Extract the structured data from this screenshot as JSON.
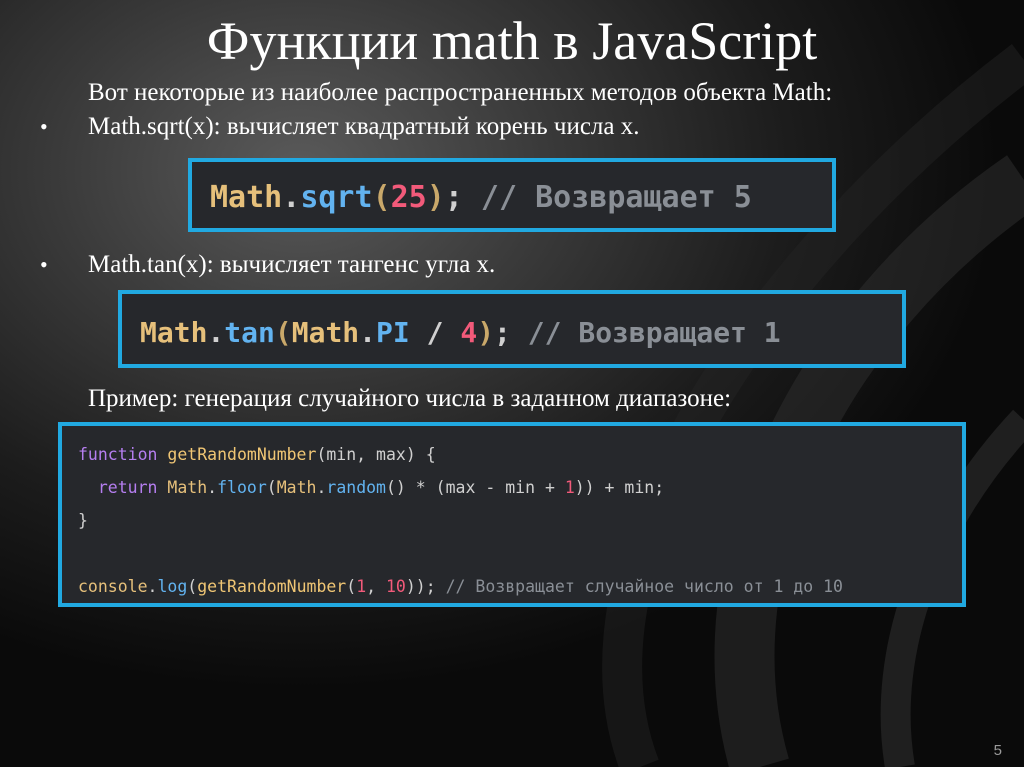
{
  "slide": {
    "title": "Функции math в JavaScript",
    "intro": "Вот некоторые из наиболее распространенных методов объекта Math:",
    "bullet_symbol": "•",
    "bullet1": "Math.sqrt(x): вычисляет квадратный корень числа x.",
    "bullet2": "Math.tan(x): вычисляет тангенс угла x.",
    "example_caption": "Пример: генерация случайного числа в заданном диапазоне:",
    "page_number": "5"
  },
  "code1": {
    "obj": "Math",
    "dot": ".",
    "method": "sqrt",
    "open": "(",
    "arg": "25",
    "close": ")",
    "semi": ";",
    "comment": " // Возвращает 5"
  },
  "code2": {
    "obj": "Math",
    "dot": ".",
    "method": "tan",
    "open": "(",
    "obj2": "Math",
    "dot2": ".",
    "const": "PI",
    "op": " / ",
    "arg": "4",
    "close": ")",
    "semi": ";",
    "comment": " // Возвращает 1"
  },
  "code3": {
    "l1_kw": "function",
    "l1_fn": " getRandomNumber",
    "l1_rest": "(min, max) {",
    "l2_indent": "  ",
    "l2_kw": "return",
    "l2_obj": " Math",
    "l2_dot": ".",
    "l2_floor": "floor",
    "l2_p1": "(",
    "l2_obj2": "Math",
    "l2_dot2": ".",
    "l2_random": "random",
    "l2_rest1": "() * (max - min + ",
    "l2_num": "1",
    "l2_rest2": ")) + min;",
    "l3": "}",
    "l5_obj": "console",
    "l5_dot": ".",
    "l5_log": "log",
    "l5_p": "(",
    "l5_fn": "getRandomNumber",
    "l5_p2": "(",
    "l5_n1": "1",
    "l5_sep": ", ",
    "l5_n2": "10",
    "l5_close": "));",
    "l5_comment": " // Возвращает случайное число от 1 до 10"
  }
}
